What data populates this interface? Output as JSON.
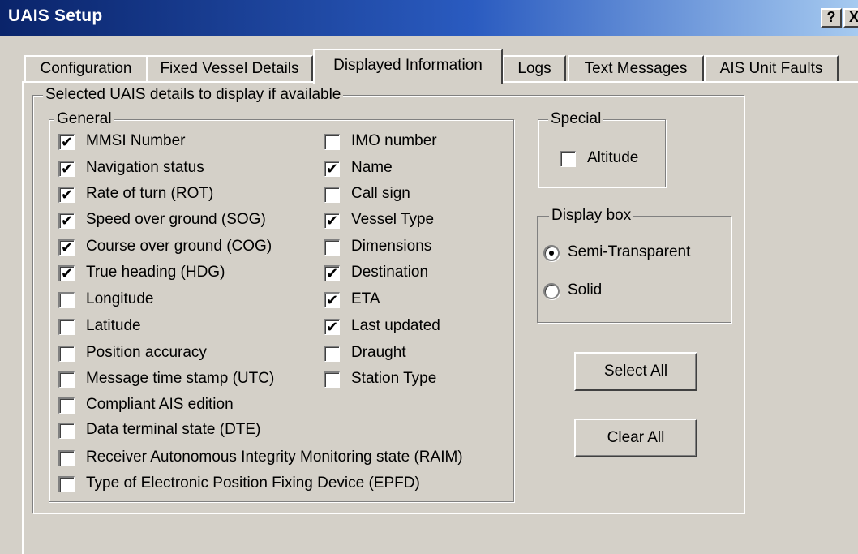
{
  "window": {
    "title": "UAIS Setup",
    "help_label": "?",
    "close_label": "X"
  },
  "tabs": [
    {
      "label": "Configuration",
      "active": false
    },
    {
      "label": "Fixed Vessel Details",
      "active": false
    },
    {
      "label": "Displayed Information",
      "active": true
    },
    {
      "label": "Logs",
      "active": false
    },
    {
      "label": "Text Messages",
      "active": false
    },
    {
      "label": "AIS Unit Faults",
      "active": false
    }
  ],
  "details_group": {
    "legend": "Selected UAIS details to display if available"
  },
  "general": {
    "legend": "General",
    "left_column": [
      {
        "label": "MMSI Number",
        "checked": true
      },
      {
        "label": "Navigation status",
        "checked": true
      },
      {
        "label": "Rate of turn (ROT)",
        "checked": true
      },
      {
        "label": "Speed over ground (SOG)",
        "checked": true
      },
      {
        "label": "Course over ground (COG)",
        "checked": true
      },
      {
        "label": "True heading (HDG)",
        "checked": true
      },
      {
        "label": "Longitude",
        "checked": false
      },
      {
        "label": "Latitude",
        "checked": false
      },
      {
        "label": "Position accuracy",
        "checked": false
      },
      {
        "label": "Message time stamp (UTC)",
        "checked": false
      },
      {
        "label": "Compliant AIS edition",
        "checked": false
      },
      {
        "label": "Data terminal state (DTE)",
        "checked": false
      },
      {
        "label": "Receiver Autonomous Integrity Monitoring state (RAIM)",
        "checked": false
      },
      {
        "label": "Type of Electronic Position Fixing Device (EPFD)",
        "checked": false
      }
    ],
    "right_column": [
      {
        "label": "IMO number",
        "checked": false
      },
      {
        "label": "Name",
        "checked": true
      },
      {
        "label": "Call sign",
        "checked": false
      },
      {
        "label": "Vessel Type",
        "checked": true
      },
      {
        "label": "Dimensions",
        "checked": false
      },
      {
        "label": "Destination",
        "checked": true
      },
      {
        "label": "ETA",
        "checked": true
      },
      {
        "label": "Last updated",
        "checked": true
      },
      {
        "label": "Draught",
        "checked": false
      },
      {
        "label": "Station Type",
        "checked": false
      }
    ]
  },
  "special": {
    "legend": "Special",
    "altitude": {
      "label": "Altitude",
      "checked": false
    }
  },
  "display_box": {
    "legend": "Display box",
    "options": [
      {
        "label": "Semi-Transparent",
        "selected": true
      },
      {
        "label": "Solid",
        "selected": false
      }
    ]
  },
  "buttons": {
    "select_all": "Select All",
    "clear_all": "Clear All"
  },
  "check_glyph": "✔"
}
